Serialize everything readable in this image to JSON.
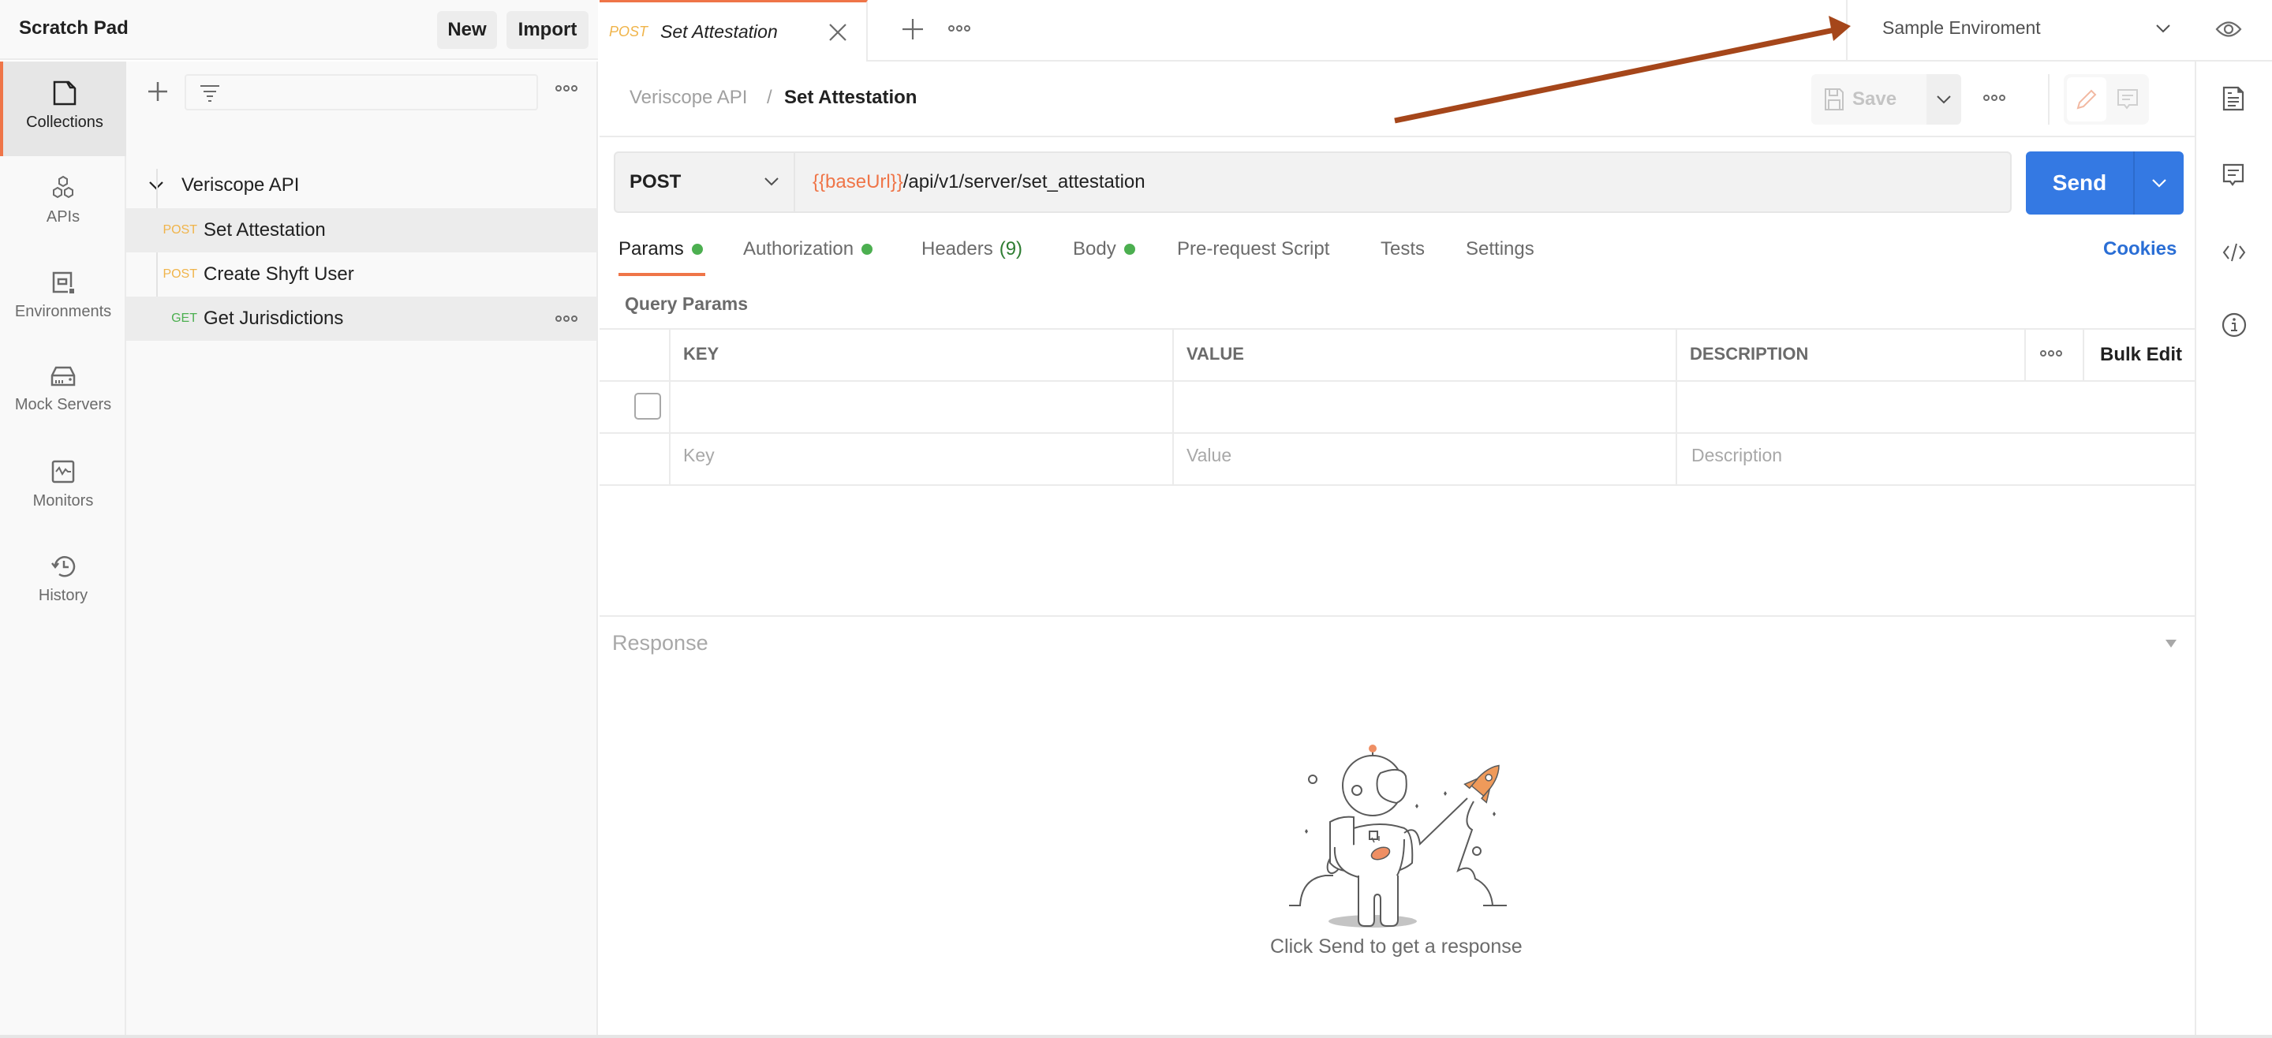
{
  "workspace": {
    "name": "Scratch Pad",
    "new_label": "New",
    "import_label": "Import"
  },
  "icon_rail": {
    "items": [
      {
        "label": "Collections",
        "icon": "collections-icon",
        "active": true
      },
      {
        "label": "APIs",
        "icon": "apis-icon",
        "active": false
      },
      {
        "label": "Environments",
        "icon": "environments-icon",
        "active": false
      },
      {
        "label": "Mock Servers",
        "icon": "mock-servers-icon",
        "active": false
      },
      {
        "label": "Monitors",
        "icon": "monitors-icon",
        "active": false
      },
      {
        "label": "History",
        "icon": "history-icon",
        "active": false
      }
    ]
  },
  "sidebar": {
    "filter_placeholder": "",
    "collection": {
      "name": "Veriscope API",
      "expanded": true,
      "requests": [
        {
          "method": "POST",
          "name": "Set Attestation",
          "selected": true
        },
        {
          "method": "POST",
          "name": "Create Shyft User",
          "selected": false
        },
        {
          "method": "GET",
          "name": "Get Jurisdictions",
          "selected": false,
          "hovered": true
        }
      ]
    }
  },
  "tabs": {
    "open": [
      {
        "method": "POST",
        "title": "Set Attestation",
        "active": true
      }
    ]
  },
  "environment": {
    "selected": "Sample Enviroment"
  },
  "breadcrumb": {
    "parent": "Veriscope API",
    "separator": "/",
    "current": "Set Attestation"
  },
  "toolbar": {
    "save_label": "Save"
  },
  "request": {
    "method": "POST",
    "url_variable": "{{baseUrl}}",
    "url_path": "/api/v1/server/set_attestation",
    "send_label": "Send"
  },
  "request_tabs": [
    {
      "label": "Params",
      "active": true,
      "dot": true
    },
    {
      "label": "Authorization",
      "active": false,
      "dot": true
    },
    {
      "label": "Headers",
      "active": false,
      "count": "(9)"
    },
    {
      "label": "Body",
      "active": false,
      "dot": true
    },
    {
      "label": "Pre-request Script",
      "active": false
    },
    {
      "label": "Tests",
      "active": false
    },
    {
      "label": "Settings",
      "active": false
    }
  ],
  "cookies_label": "Cookies",
  "query_params": {
    "title": "Query Params",
    "columns": [
      "KEY",
      "VALUE",
      "DESCRIPTION"
    ],
    "bulk_edit_label": "Bulk Edit",
    "rows": [
      {
        "key": "",
        "value": "",
        "description": "",
        "checked": false
      }
    ],
    "placeholders": {
      "key": "Key",
      "value": "Value",
      "description": "Description"
    }
  },
  "response": {
    "label": "Response",
    "empty_hint": "Click Send to get a response"
  },
  "colors": {
    "accent": "#ef7548",
    "send": "#3479e3",
    "post": "#f0b44a",
    "get": "#4caf50",
    "link": "#2a6ed5",
    "annotation_arrow": "#a5461a"
  }
}
